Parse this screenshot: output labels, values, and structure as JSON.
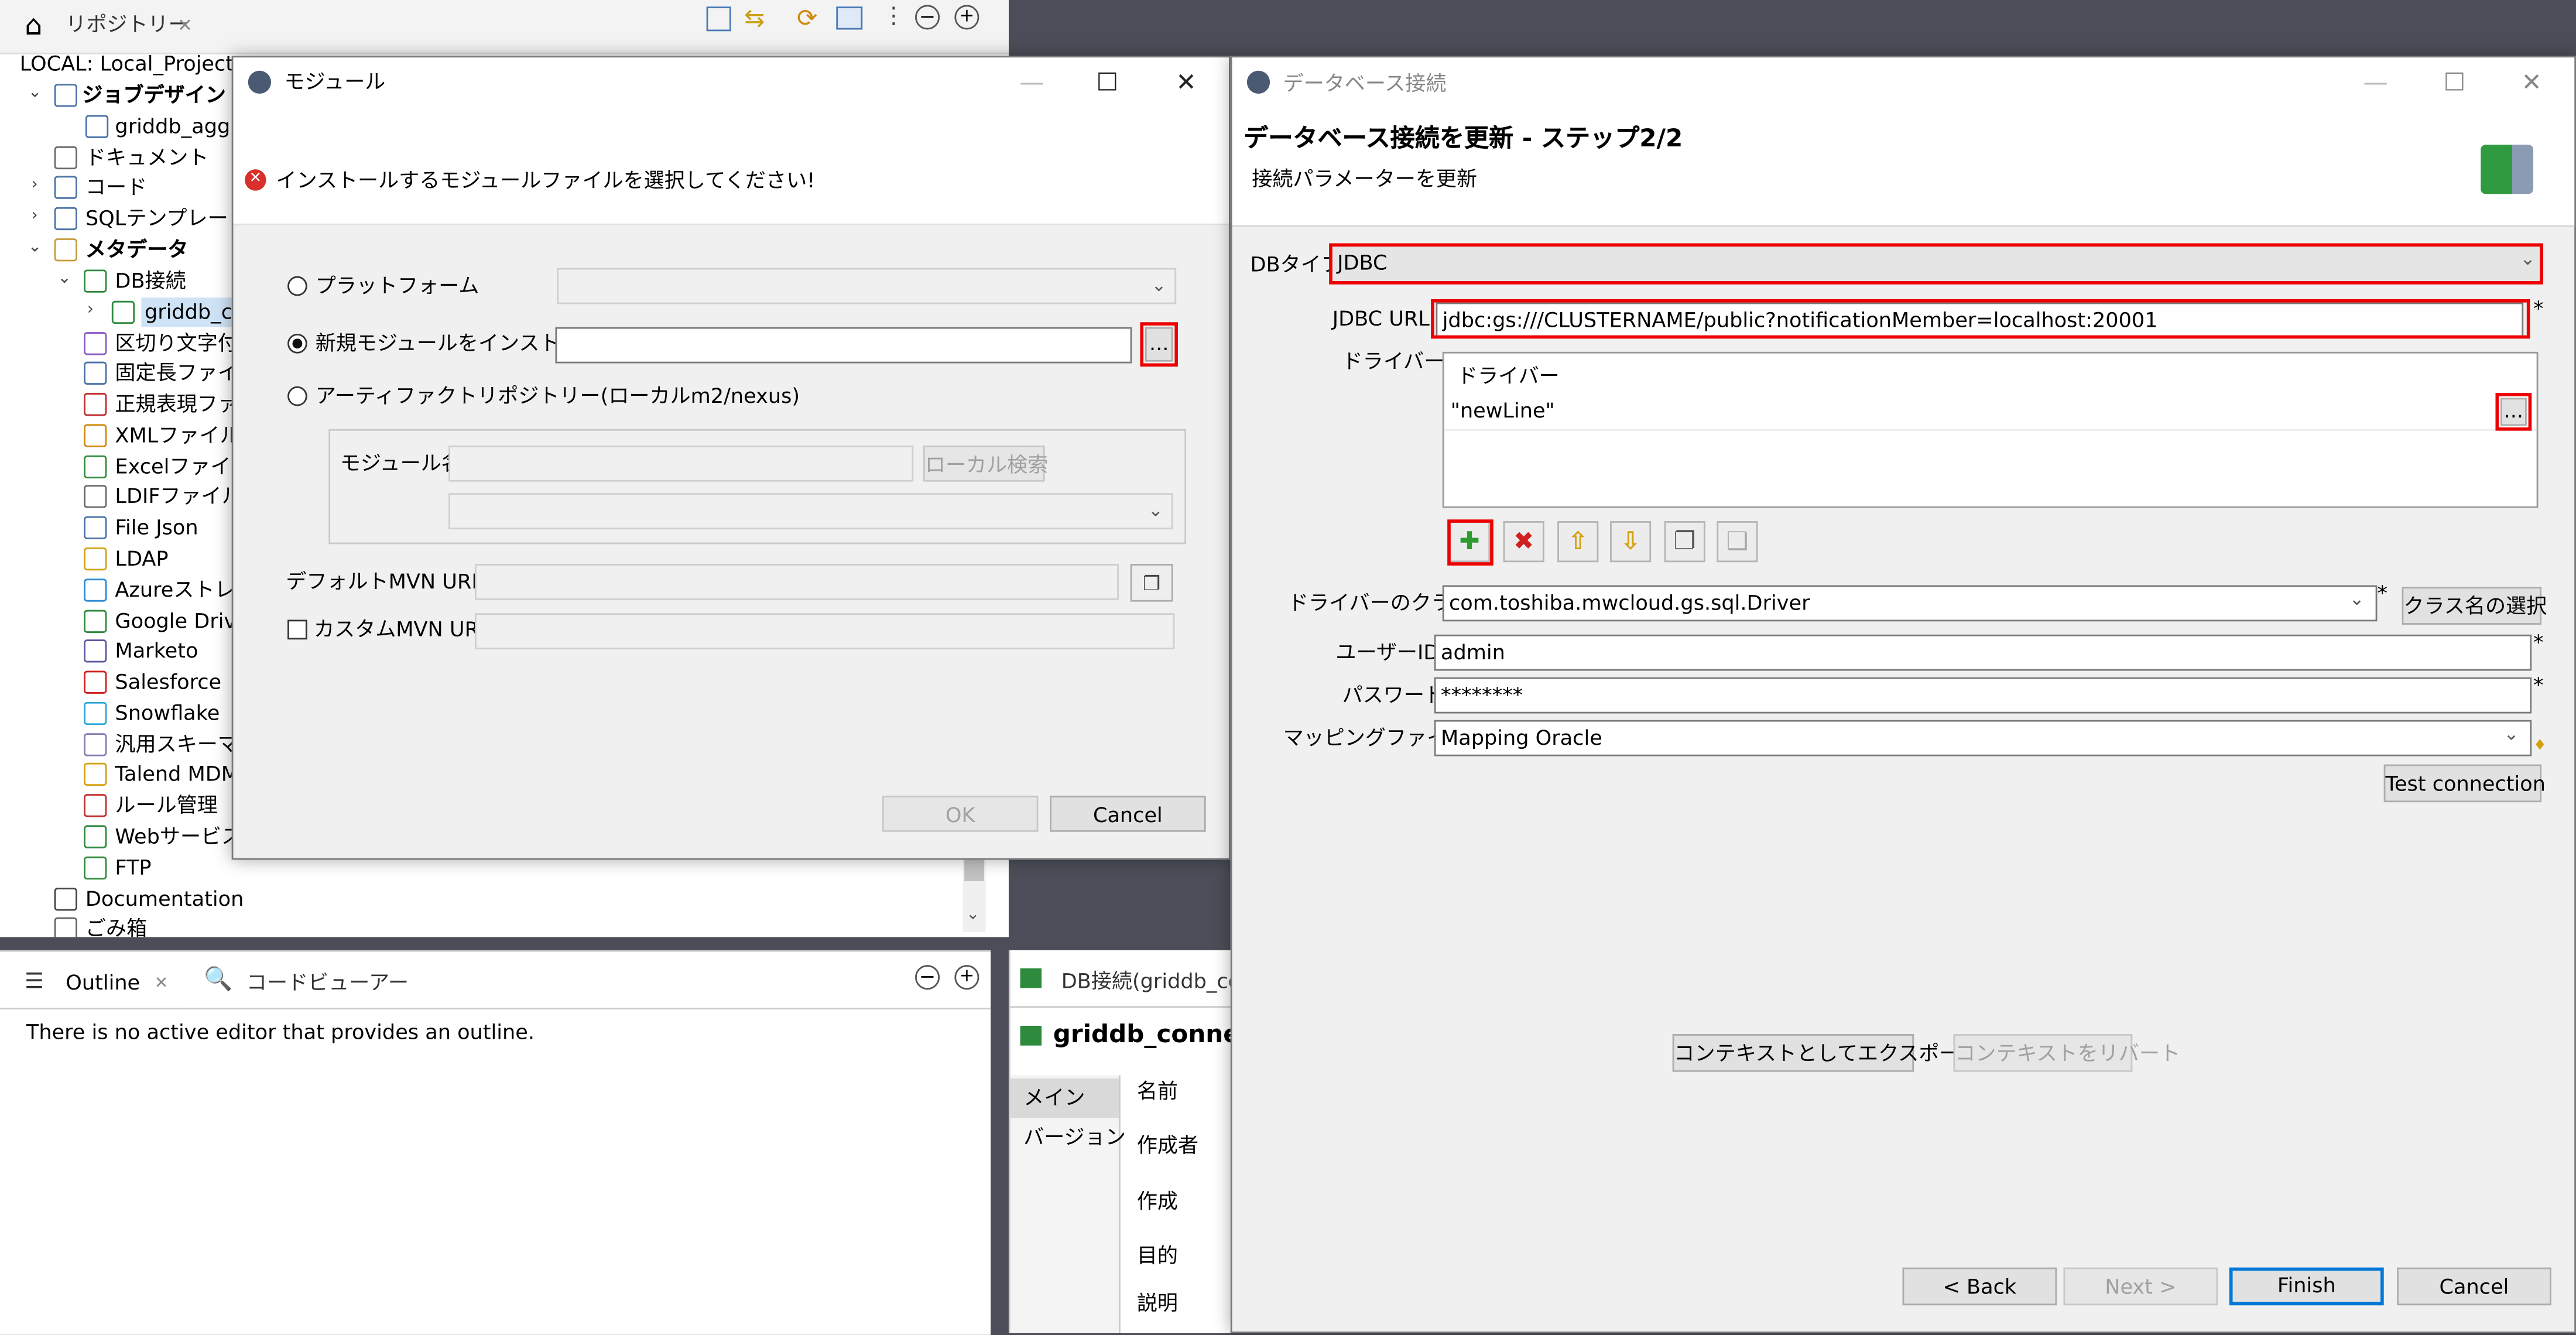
{
  "repo": {
    "tab_label": "リポジトリー",
    "project": "LOCAL: Local_Project",
    "items": [
      {
        "label": "ジョブデザイン",
        "icon": "job-design-icon",
        "bold": true
      },
      {
        "label": "griddb_aggre",
        "icon": "job-icon"
      },
      {
        "label": "ドキュメント",
        "icon": "document-icon"
      },
      {
        "label": "コード",
        "icon": "code-icon"
      },
      {
        "label": "SQLテンプレート",
        "icon": "sql-template-icon"
      },
      {
        "label": "メタデータ",
        "icon": "metadata-icon",
        "bold": true
      },
      {
        "label": "DB接続",
        "icon": "db-connection-icon"
      },
      {
        "label": "griddb_co",
        "icon": "db-icon"
      },
      {
        "label": "区切り文字付",
        "icon": "delimited-file-icon"
      },
      {
        "label": "固定長ファイル",
        "icon": "positional-file-icon"
      },
      {
        "label": "正規表現ファ",
        "icon": "regex-file-icon"
      },
      {
        "label": "XMLファイル",
        "icon": "xml-file-icon"
      },
      {
        "label": "Excelファイル",
        "icon": "excel-file-icon"
      },
      {
        "label": "LDIFファイル",
        "icon": "ldif-file-icon"
      },
      {
        "label": "File Json",
        "icon": "json-file-icon"
      },
      {
        "label": "LDAP",
        "icon": "ldap-icon"
      },
      {
        "label": "Azureストレー",
        "icon": "azure-storage-icon"
      },
      {
        "label": "Google Drive",
        "icon": "google-drive-icon"
      },
      {
        "label": "Marketo",
        "icon": "marketo-icon"
      },
      {
        "label": "Salesforce",
        "icon": "salesforce-icon"
      },
      {
        "label": "Snowflake",
        "icon": "snowflake-icon"
      },
      {
        "label": "汎用スキーマ",
        "icon": "generic-schema-icon"
      },
      {
        "label": "Talend MDM",
        "icon": "talend-mdm-icon"
      },
      {
        "label": "ルール管理",
        "icon": "rules-icon"
      },
      {
        "label": "Webサービス",
        "icon": "web-service-icon"
      },
      {
        "label": "FTP",
        "icon": "ftp-icon"
      },
      {
        "label": "Documentation",
        "icon": "documentation-icon"
      },
      {
        "label": "ごみ箱",
        "icon": "recycle-bin-icon"
      }
    ]
  },
  "outline": {
    "tab_outline": "Outline",
    "tab_code_viewer": "コードビューアー",
    "message": "There is no active editor that provides an outline."
  },
  "props": {
    "tab_label": "DB接続(griddb_co",
    "title": "griddb_connect",
    "side_tabs": [
      "メイン",
      "バージョン"
    ],
    "fields": [
      "名前",
      "作成者",
      "作成",
      "目的",
      "説明"
    ]
  },
  "module_dialog": {
    "title": "モジュール",
    "error_message": "インストールするモジュールファイルを選択してください!",
    "opt_platform": "プラットフォーム",
    "opt_install_new": "新規モジュールをインストール",
    "opt_artifact": "アーティファクトリポジトリー(ローカルm2/nexus)",
    "module_name_label": "モジュール名",
    "local_search": "ローカル検索",
    "default_mvn_label": "デフォルトMVN URI",
    "custom_mvn_label": "カスタムMVN URI",
    "browse": "...",
    "ok": "OK",
    "cancel": "Cancel"
  },
  "db_dialog": {
    "window_title": "データベース接続",
    "heading": "データベース接続を更新 - ステップ2/2",
    "subheading": "接続パラメーターを更新",
    "db_type_label": "DBタイプ",
    "db_type_value": "JDBC",
    "jdbc_url_label": "JDBC URL",
    "jdbc_url_value": "jdbc:gs:///CLUSTERNAME/public?notificationMember=localhost:20001",
    "driver_label": "ドライバー",
    "driver_table_header": "ドライバー",
    "driver_row": "\"newLine\"",
    "browse": "...",
    "driver_class_label": "ドライバーのクラス",
    "driver_class_value": "com.toshiba.mwcloud.gs.sql.Driver",
    "select_class": "クラス名の選択",
    "user_label": "ユーザーID",
    "user_value": "admin",
    "password_label": "パスワード",
    "password_value": "********",
    "mapping_label": "マッピングファイル",
    "mapping_value": "Mapping Oracle",
    "test_connection": "Test connection",
    "export_context": "コンテキストとしてエクスポート",
    "revert_context": "コンテキストをリバート",
    "required_mark": "*",
    "back": "< Back",
    "next": "Next >",
    "finish": "Finish",
    "cancel": "Cancel"
  }
}
